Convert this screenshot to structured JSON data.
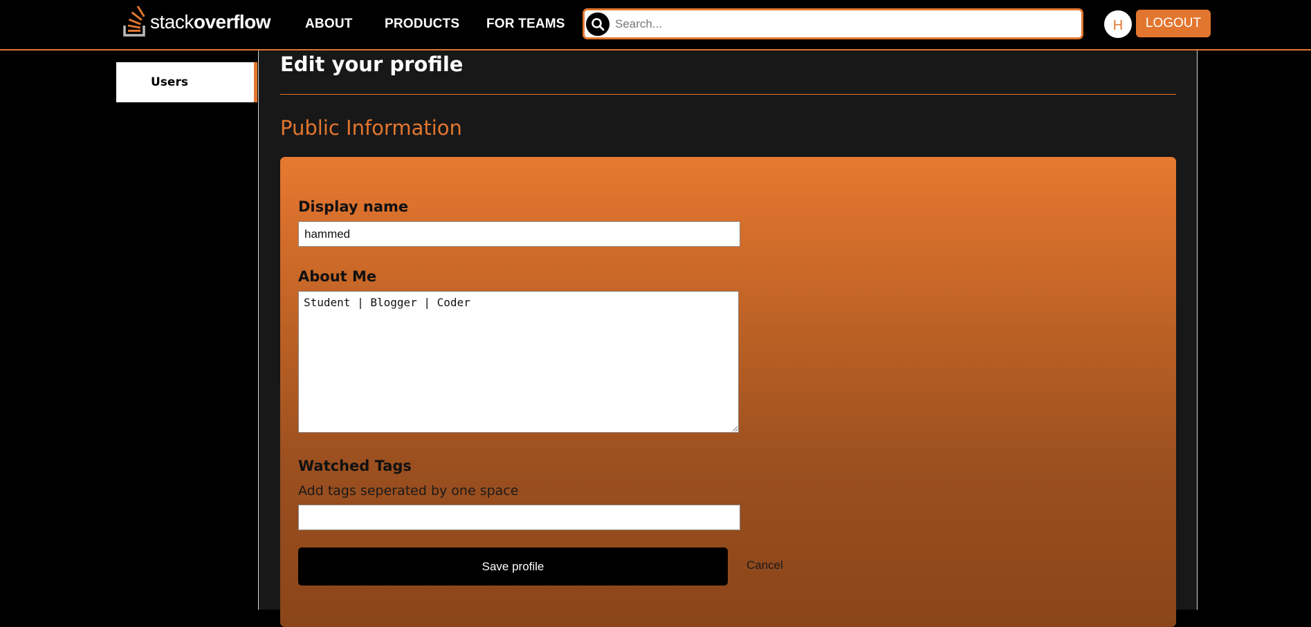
{
  "header": {
    "logo": {
      "text_light": "stack",
      "text_bold": "overflow"
    },
    "nav": [
      {
        "label": "ABOUT"
      },
      {
        "label": "PRODUCTS"
      },
      {
        "label": "FOR TEAMS"
      }
    ],
    "search": {
      "placeholder": "Search...",
      "value": ""
    },
    "avatar_initial": "H",
    "logout_label": "LOGOUT"
  },
  "sidebar": {
    "items": [
      {
        "label": "Users",
        "active": true
      }
    ]
  },
  "main": {
    "title": "Edit your profile",
    "section_title": "Public Information",
    "form": {
      "display_name": {
        "label": "Display name",
        "value": "hammed"
      },
      "about_me": {
        "label": "About Me",
        "value": "Student | Blogger | Coder"
      },
      "watched_tags": {
        "label": "Watched Tags",
        "hint": "Add tags seperated by one space",
        "value": ""
      },
      "save_label": "Save profile",
      "cancel_label": "Cancel"
    }
  },
  "theme": {
    "accent": "#e2762f",
    "background": "#000000",
    "panel": "#181818"
  }
}
